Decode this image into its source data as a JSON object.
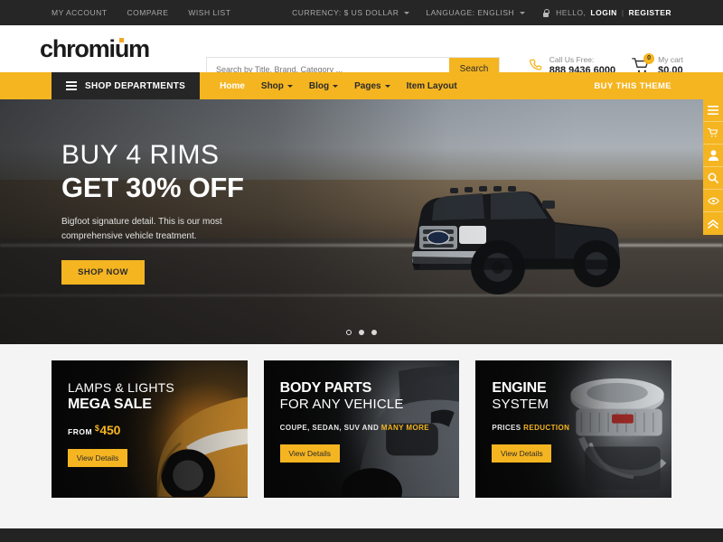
{
  "topbar": {
    "left_links": [
      {
        "label": "MY ACCOUNT",
        "name": "my-account"
      },
      {
        "label": "COMPARE",
        "name": "compare"
      },
      {
        "label": "WISH LIST",
        "name": "wish-list"
      }
    ],
    "currency": "CURRENCY: $ US DOLLAR",
    "language": "LANGUAGE: ENGLISH",
    "hello": "HELLO,",
    "login": "LOGIN",
    "separator": "|",
    "register": "REGISTER"
  },
  "header": {
    "logo": "chromium",
    "search_placeholder": "Search by Title, Brand, Category ...",
    "search_value": "",
    "search_button": "Search",
    "call_label": "Call Us Free:",
    "call_number": "888 9436 6000",
    "cart_count": "0",
    "cart_label": "My cart",
    "cart_total": "$0.00"
  },
  "nav": {
    "departments": "SHOP DEPARTMENTS",
    "items": [
      {
        "label": "Home",
        "caret": false,
        "active": true
      },
      {
        "label": "Shop",
        "caret": true,
        "active": false
      },
      {
        "label": "Blog",
        "caret": true,
        "active": false
      },
      {
        "label": "Pages",
        "caret": true,
        "active": false
      },
      {
        "label": "Item Layout",
        "caret": false,
        "active": false
      }
    ],
    "buy_theme": "BUY THIS THEME"
  },
  "hero": {
    "line1": "BUY 4 RIMS",
    "line2": "GET 30% OFF",
    "subtitle": "Bigfoot signature detail. This is our most comprehensive vehicle treatment.",
    "cta": "SHOP NOW",
    "slides": 3,
    "active_slide": 1
  },
  "side_tools": [
    {
      "name": "menu-icon"
    },
    {
      "name": "cart-icon"
    },
    {
      "name": "user-icon"
    },
    {
      "name": "search-icon"
    },
    {
      "name": "eye-icon"
    },
    {
      "name": "chevron-up-icon"
    }
  ],
  "promos": [
    {
      "line1": "LAMPS & LIGHTS",
      "line1_bold": false,
      "line2": "MEGA SALE",
      "line2_light": false,
      "price_prefix": "FROM",
      "currency": "$",
      "amount": "450",
      "sub_text": "",
      "sub_highlight": "",
      "button": "View Details"
    },
    {
      "line1": "BODY PARTS",
      "line1_bold": true,
      "line2": "FOR ANY VEHICLE",
      "line2_light": true,
      "price_prefix": "",
      "currency": "",
      "amount": "",
      "sub_text": "COUPE, SEDAN, SUV AND ",
      "sub_highlight": "MANY MORE",
      "button": "View Details"
    },
    {
      "line1": "ENGINE",
      "line1_bold": true,
      "line2": "SYSTEM",
      "line2_light": true,
      "price_prefix": "",
      "currency": "",
      "amount": "",
      "sub_text": "PRICES ",
      "sub_highlight": "REDUCTION",
      "button": "View Details"
    }
  ],
  "colors": {
    "accent": "#f5b521",
    "dark": "#262626",
    "page_bg": "#f4f4f4"
  }
}
